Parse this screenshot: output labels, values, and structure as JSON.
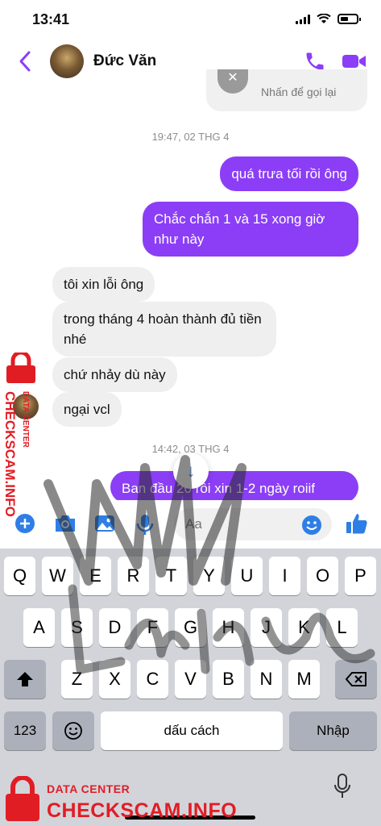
{
  "status_bar": {
    "time": "13:41",
    "icons": [
      "signal-icon",
      "wifi-icon",
      "battery-icon"
    ]
  },
  "header": {
    "contact_name": "Đức Văn",
    "icons": [
      "back-icon",
      "phone-icon",
      "video-icon"
    ],
    "accent": "#8b3ef6"
  },
  "chat": {
    "missed_call": {
      "text": "Nhấn để gọi lại"
    },
    "timestamp_1": "19:47, 02 THG 4",
    "outgoing_1": "quá trưa tối rồi ông",
    "outgoing_2": "Chắc chắn 1 và 15 xong giờ như này",
    "incoming": [
      "tôi xin lỗi ông",
      "trong tháng 4 hoàn thành đủ tiền nhé",
      "chứ nhảy dù này",
      "ngại vcl"
    ],
    "timestamp_2": "14:42, 03 THG 4",
    "outgoing_3": "Ban đầu 20 rồi xin 1-2 ngày roiif"
  },
  "composer": {
    "placeholder": "Aa",
    "icons": [
      "plus-icon",
      "camera-icon",
      "image-icon",
      "mic-icon",
      "emoji-icon",
      "like-icon"
    ]
  },
  "keyboard": {
    "row1": [
      "Q",
      "W",
      "E",
      "R",
      "T",
      "Y",
      "U",
      "I",
      "O",
      "P"
    ],
    "row2": [
      "A",
      "S",
      "D",
      "F",
      "G",
      "H",
      "J",
      "K",
      "L"
    ],
    "row3": [
      "Z",
      "X",
      "C",
      "V",
      "B",
      "N",
      "M"
    ],
    "numbers_key": "123",
    "space_key": "dấu cách",
    "return_key": "Nhập"
  },
  "watermark": {
    "sub": "DATA CENTER",
    "brand": "CHECKSCAM.INFO",
    "color": "#e11d24"
  }
}
